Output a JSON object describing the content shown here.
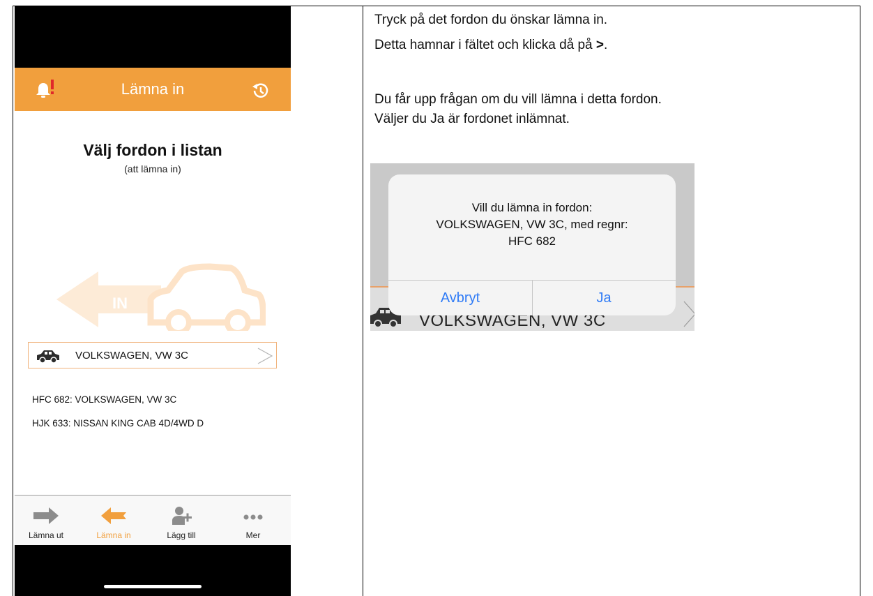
{
  "phone": {
    "nav_title": "Lämna in",
    "heading": "Välj fordon i listan",
    "subheading": "(att lämna in)",
    "illustration_label": "IN",
    "selected_vehicle": "VOLKSWAGEN, VW  3C",
    "vehicles": [
      "HFC 682:  VOLKSWAGEN, VW  3C",
      "HJK 633:  NISSAN KING CAB 4D/4WD D"
    ],
    "tabs": [
      {
        "label": "Lämna ut",
        "icon": "arrow-right-icon",
        "active": false
      },
      {
        "label": "Lämna in",
        "icon": "arrow-left-icon",
        "active": true
      },
      {
        "label": "Lägg till",
        "icon": "add-user-icon",
        "active": false
      },
      {
        "label": "Mer",
        "icon": "more-icon",
        "active": false
      }
    ],
    "colors": {
      "accent": "#f19f3d",
      "illustration": "#fdebd7"
    }
  },
  "instructions": {
    "line1": "Tryck på det fordon du önskar lämna in.",
    "line2_before": "Detta hamnar i fältet och klicka då på ",
    "line2_symbol": ">",
    "line2_after": ".",
    "line3": "Du får upp frågan om du vill lämna i detta fordon.",
    "line4": "Väljer du Ja är fordonet inlämnat."
  },
  "dialog": {
    "message_line1": "Vill du lämna in fordon:",
    "message_line2": "VOLKSWAGEN, VW  3C, med regnr:",
    "message_line3": "HFC 682",
    "cancel_label": "Avbryt",
    "confirm_label": "Ja",
    "background_text": "VOLKSWAGEN, VW  3C",
    "button_color": "#2f7bf6"
  }
}
